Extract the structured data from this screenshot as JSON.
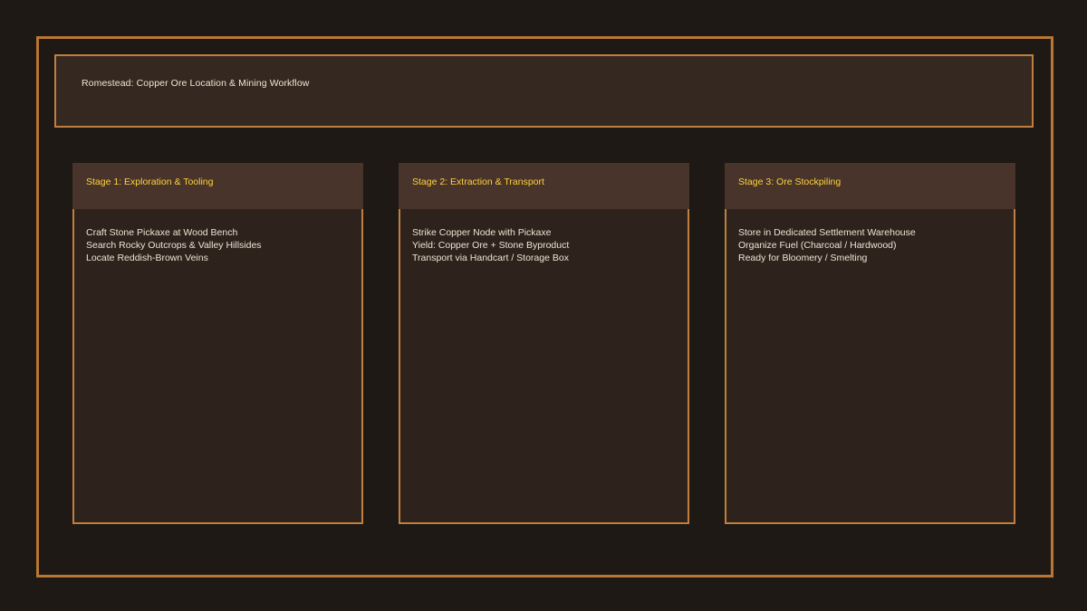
{
  "title": "Romestead: Copper Ore Location & Mining Workflow",
  "stages": [
    {
      "title": "Stage 1: Exploration & Tooling",
      "items": [
        "Craft Stone Pickaxe at Wood Bench",
        "Search Rocky Outcrops & Valley Hillsides",
        "Locate Reddish-Brown Veins"
      ]
    },
    {
      "title": "Stage 2: Extraction & Transport",
      "items": [
        "Strike Copper Node with Pickaxe",
        "Yield: Copper Ore + Stone Byproduct",
        "Transport via Handcart / Storage Box"
      ]
    },
    {
      "title": "Stage 3: Ore Stockpiling",
      "items": [
        "Store in Dedicated Settlement Warehouse",
        "Organize Fuel (Charcoal / Hardwood)",
        "Ready for Bloomery / Smelting"
      ]
    }
  ],
  "colors": {
    "background": "#1e1914",
    "frame": "#b87733",
    "stage_title": "#ffd23c",
    "text": "#efe3d3"
  }
}
